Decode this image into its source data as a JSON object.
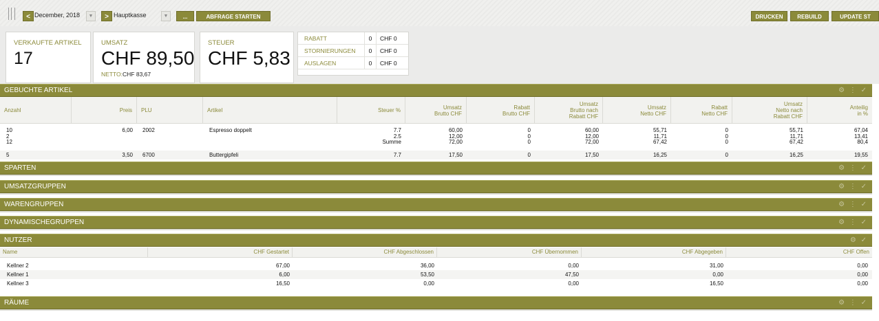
{
  "toolbar": {
    "prev_label": "<",
    "next_label": ">",
    "month": "December, 2018",
    "register": "Hauptkasse",
    "more_label": "...",
    "query_label": "ABFRAGE STARTEN",
    "print_label": "DRUCKEN",
    "rebuild_label": "REBUILD",
    "update_label": "UPDATE ST"
  },
  "summary": {
    "sold_label": "VERKAUFTE ARTIKEL",
    "sold_value": "17",
    "revenue_label": "UMSATZ",
    "revenue_value": "CHF 89,50",
    "net_label": "NETTO:",
    "net_value": "CHF 83,67",
    "tax_label": "STEUER",
    "tax_value": "CHF 5,83",
    "mini": [
      {
        "label": "RABATT",
        "count": "0",
        "amount": "CHF 0"
      },
      {
        "label": "STORNIERUNGEN",
        "count": "0",
        "amount": "CHF 0"
      },
      {
        "label": "AUSLAGEN",
        "count": "0",
        "amount": "CHF 0"
      }
    ]
  },
  "sections": {
    "articles": "GEBUCHTE ARTIKEL",
    "divisions": "SPARTEN",
    "revenue_groups": "UMSATZGRUPPEN",
    "product_groups": "WARENGRUPPEN",
    "dynamic_groups": "DYNAMISCHEGRUPPEN",
    "users": "NUTZER",
    "rooms": "RÄUME"
  },
  "articles": {
    "headers": {
      "qty": "Anzahl",
      "price": "Preis",
      "plu": "PLU",
      "item": "Artikel",
      "tax": "Steuer %",
      "gross": [
        "Umsatz",
        "Brutto CHF"
      ],
      "discount_gross": [
        "Rabatt",
        "Brutto CHF"
      ],
      "gross_after": [
        "Umsatz",
        "Brutto nach",
        "Rabatt CHF"
      ],
      "net": [
        "Umsatz",
        "Netto CHF"
      ],
      "discount_net": [
        "Rabatt",
        "Netto CHF"
      ],
      "net_after": [
        "Umsatz",
        "Netto nach",
        "Rabatt CHF"
      ],
      "share": [
        "Anteilig",
        "in %"
      ]
    },
    "rows": [
      {
        "qty": [
          "10",
          "2",
          "12"
        ],
        "price": "6,00",
        "plu": "2002",
        "item": "Espresso doppelt",
        "tax": [
          "7.7",
          "2.5",
          "Summe"
        ],
        "gross": [
          "60,00",
          "12,00",
          "72,00"
        ],
        "discount_gross": [
          "0",
          "0",
          "0"
        ],
        "gross_after": [
          "60,00",
          "12,00",
          "72,00"
        ],
        "net": [
          "55,71",
          "11,71",
          "67,42"
        ],
        "discount_net": [
          "0",
          "0",
          "0"
        ],
        "net_after": [
          "55,71",
          "11,71",
          "67,42"
        ],
        "share": [
          "67,04",
          "13,41",
          "80,4"
        ]
      },
      {
        "qty": [
          "5"
        ],
        "price": "3,50",
        "plu": "6700",
        "item": "Buttergipfeli",
        "tax": [
          "7.7"
        ],
        "gross": [
          "17,50"
        ],
        "discount_gross": [
          "0"
        ],
        "gross_after": [
          "17,50"
        ],
        "net": [
          "16,25"
        ],
        "discount_net": [
          "0"
        ],
        "net_after": [
          "16,25"
        ],
        "share": [
          "19,55"
        ]
      }
    ]
  },
  "users": {
    "headers": [
      "Name",
      "CHF Gestartet",
      "CHF Abgeschlossen",
      "CHF Übernommen",
      "CHF Abgegeben",
      "CHF Offen"
    ],
    "rows": [
      [
        "Kellner 2",
        "67,00",
        "36,00",
        "0,00",
        "31,00",
        "0,00"
      ],
      [
        "Kellner 1",
        "6,00",
        "53,50",
        "47,50",
        "0,00",
        "0,00"
      ],
      [
        "Kellner 3",
        "16,50",
        "0,00",
        "0,00",
        "16,50",
        "0,00"
      ]
    ]
  },
  "colors": {
    "accent": "#8b8a3a",
    "section_bg": "#8b8a3a",
    "label": "#8b8a3a"
  },
  "icons": {
    "section_tools": [
      "settings-icon",
      "more-icon",
      "check-icon"
    ]
  }
}
